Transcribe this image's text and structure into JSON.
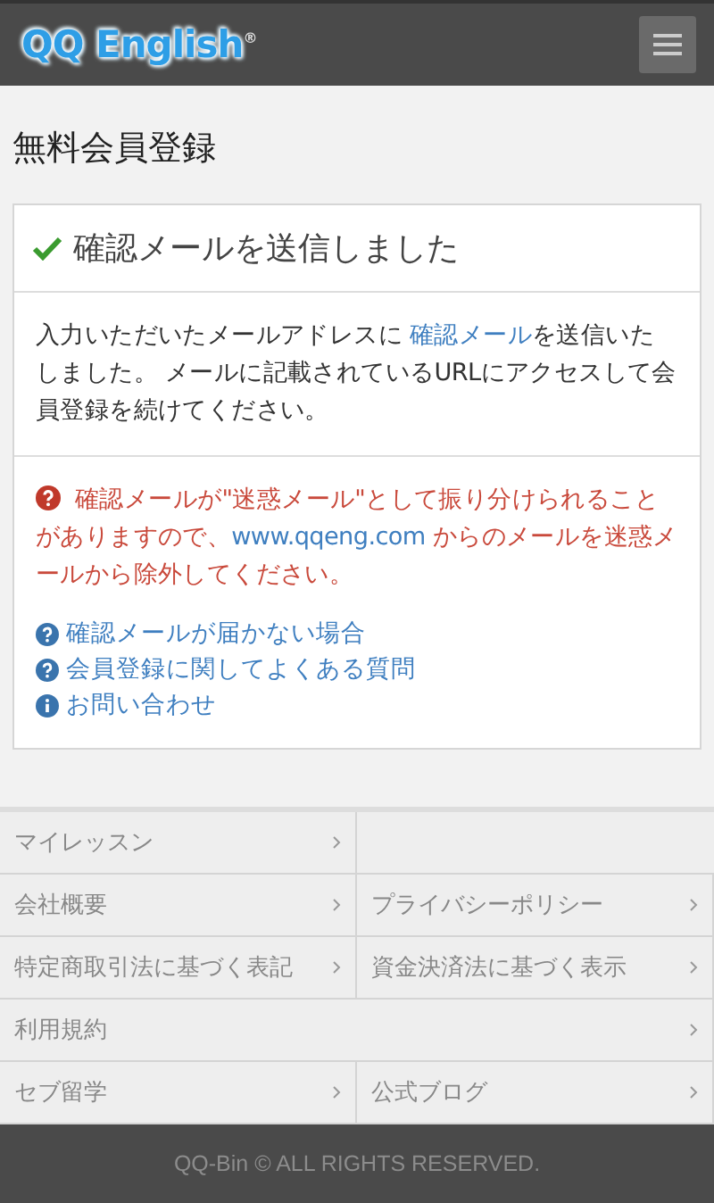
{
  "header": {
    "logo": "QQ English",
    "logo_mark": "®"
  },
  "page_title": "無料会員登録",
  "card": {
    "title": "確認メールを送信しました",
    "message": {
      "before": "入力いただいたメールアドレスに ",
      "link": "確認メール",
      "after": "を送信いたしました。 メールに記載されているURLにアクセスして会員登録を続けてください。"
    },
    "warning": {
      "before": "確認メールが\"迷惑メール\"として振り分けられることがありますので、",
      "link": "www.qqeng.com",
      "after": " からのメールを迷惑メールから除外してください。"
    },
    "help_links": [
      {
        "kind": "question",
        "label": "確認メールが届かない場合"
      },
      {
        "kind": "question",
        "label": "会員登録に関してよくある質問"
      },
      {
        "kind": "info",
        "label": "お問い合わせ"
      }
    ]
  },
  "footer_links": [
    {
      "kind": "pair",
      "links": [
        "マイレッスン"
      ]
    },
    {
      "kind": "pair",
      "links": [
        "会社概要",
        "プライバシーポリシー"
      ]
    },
    {
      "kind": "pair",
      "links": [
        "特定商取引法に基づく表記",
        "資金決済法に基づく表示"
      ]
    },
    {
      "kind": "wide",
      "links": [
        "利用規約"
      ]
    },
    {
      "kind": "pair",
      "links": [
        "セブ留学",
        "公式ブログ"
      ]
    }
  ],
  "copyright": "QQ-Bin © ALL RIGHTS RESERVED."
}
